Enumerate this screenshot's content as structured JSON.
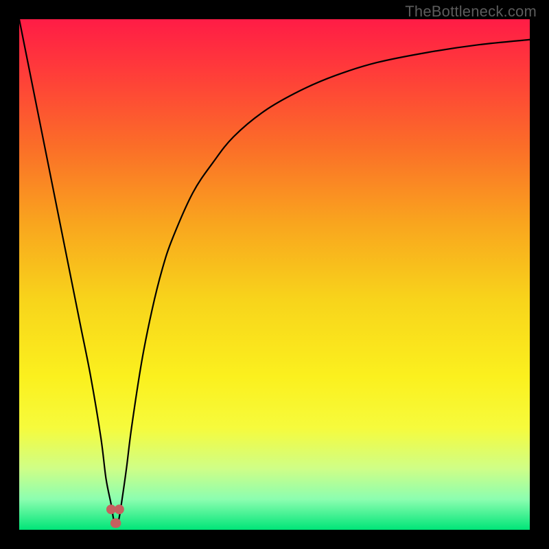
{
  "watermark": "TheBottleneck.com",
  "colors": {
    "frame": "#000000",
    "curve": "#000000",
    "marker": "#C6605F",
    "gradient_stops": [
      {
        "offset": 0.0,
        "color": "#FF1C46"
      },
      {
        "offset": 0.1,
        "color": "#FF3B3A"
      },
      {
        "offset": 0.25,
        "color": "#FB6E28"
      },
      {
        "offset": 0.4,
        "color": "#F9A51E"
      },
      {
        "offset": 0.55,
        "color": "#F8D41B"
      },
      {
        "offset": 0.7,
        "color": "#FBF01E"
      },
      {
        "offset": 0.8,
        "color": "#F6FB3C"
      },
      {
        "offset": 0.88,
        "color": "#CFFE87"
      },
      {
        "offset": 0.94,
        "color": "#8CFEB0"
      },
      {
        "offset": 1.0,
        "color": "#00E578"
      }
    ]
  },
  "chart_data": {
    "type": "line",
    "title": "",
    "xlabel": "",
    "ylabel": "",
    "xlim": [
      0,
      100
    ],
    "ylim": [
      0,
      100
    ],
    "annotations": [
      "TheBottleneck.com"
    ],
    "series": [
      {
        "name": "bottleneck-curve",
        "x": [
          0,
          2,
          4,
          6,
          8,
          10,
          12,
          14,
          16,
          17,
          18,
          18.5,
          19,
          19.5,
          20,
          21,
          22,
          24,
          26,
          28,
          30,
          34,
          38,
          42,
          48,
          55,
          62,
          70,
          80,
          90,
          100
        ],
        "y": [
          100,
          90,
          80,
          70,
          60,
          50,
          40,
          30,
          18,
          10,
          5,
          2,
          1,
          2,
          5,
          12,
          20,
          33,
          43,
          51,
          57,
          66,
          72,
          77,
          82,
          86,
          89,
          91.5,
          93.5,
          95,
          96
        ]
      }
    ],
    "markers": {
      "name": "minimum-cluster",
      "x": [
        18.0,
        18.8,
        19.0,
        19.6
      ],
      "y": [
        4.0,
        1.3,
        1.3,
        4.0
      ]
    }
  }
}
